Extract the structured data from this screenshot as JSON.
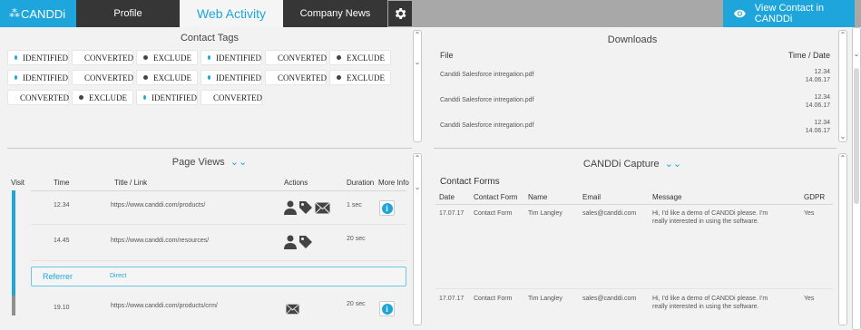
{
  "app": {
    "logo_text": "CANDDi",
    "logo_mark": "⁂"
  },
  "tabs": [
    {
      "label": "Profile"
    },
    {
      "label": "Web Activity"
    },
    {
      "label": "Company News"
    }
  ],
  "header": {
    "view_contact_label": "View Contact in CANDDi",
    "gear_icon": "gear-icon",
    "eye_icon": "eye-icon"
  },
  "colors": {
    "accent": "#1ea6dc",
    "identified": "#1ea6dc",
    "converted": "#2ecc71",
    "exclude": "#444444",
    "dark_tab": "#363636"
  },
  "contact_tags": {
    "title": "Contact Tags",
    "rows": [
      [
        "IDENTIFIED",
        "CONVERTED",
        "EXCLUDE",
        "IDENTIFIED",
        "CONVERTED",
        "EXCLUDE"
      ],
      [
        "IDENTIFIED",
        "CONVERTED",
        "EXCLUDE",
        "IDENTIFIED",
        "CONVERTED",
        "EXCLUDE"
      ],
      [
        "CONVERTED",
        "EXCLUDE",
        "IDENTIFIED",
        "CONVERTED"
      ]
    ]
  },
  "downloads": {
    "title": "Downloads",
    "col_file": "File",
    "col_time": "Time / Date",
    "rows": [
      {
        "file": "Canddi Salesforce intregation.pdf",
        "time": "12.34",
        "date": "14.06.17"
      },
      {
        "file": "Canddi Salesforce intregation.pdf",
        "time": "12.34",
        "date": "14.06.17"
      },
      {
        "file": "Canddi Salesforce intregation.pdf",
        "time": "12.34",
        "date": "14.06.17"
      }
    ]
  },
  "page_views": {
    "title": "Page Views",
    "cols": {
      "visit": "Visit",
      "time": "Time",
      "title": "Title / Link",
      "actions": "Actions",
      "duration": "Duration",
      "more": "More Info"
    },
    "rows": [
      {
        "time": "12.34",
        "link": "https://www.canddi.com/products/",
        "actions": [
          "user-icon",
          "tag-icon",
          "envelope-icon"
        ],
        "duration": "1 sec",
        "info": true
      },
      {
        "time": "14.45",
        "link": "https://www.canddi.com/resources/",
        "actions": [
          "user-icon",
          "tag-icon"
        ],
        "duration": "20 sec",
        "info": false
      },
      {
        "time": "19.10",
        "link": "https://www.canddi.com/products/crm/",
        "actions": [
          "envelope-icon"
        ],
        "duration": "20 sec",
        "info": true
      }
    ],
    "referrer": {
      "label": "Referrer",
      "value": "Direct"
    }
  },
  "capture": {
    "title": "CANDDi Capture",
    "subtitle": "Contact Forms",
    "cols": {
      "date": "Date",
      "form": "Contact Form",
      "name": "Name",
      "email": "Email",
      "message": "Message",
      "gdpr": "GDPR"
    },
    "rows": [
      {
        "date": "17.07.17",
        "form": "Contact Form",
        "name": "Tim Langley",
        "email": "sales@canddi.com",
        "msg1": "Hi, I'd like a demo of CANDDi please. I'm",
        "msg2": "really interested in using the software.",
        "gdpr": "Yes"
      },
      {
        "date": "17.07.17",
        "form": "Contact Form",
        "name": "Tim Langley",
        "email": "sales@canddi.com",
        "msg1": "Hi, I'd like a demo of CANDDi please. I'm",
        "msg2": "really interested in using the software.",
        "gdpr": "Yes"
      }
    ]
  }
}
